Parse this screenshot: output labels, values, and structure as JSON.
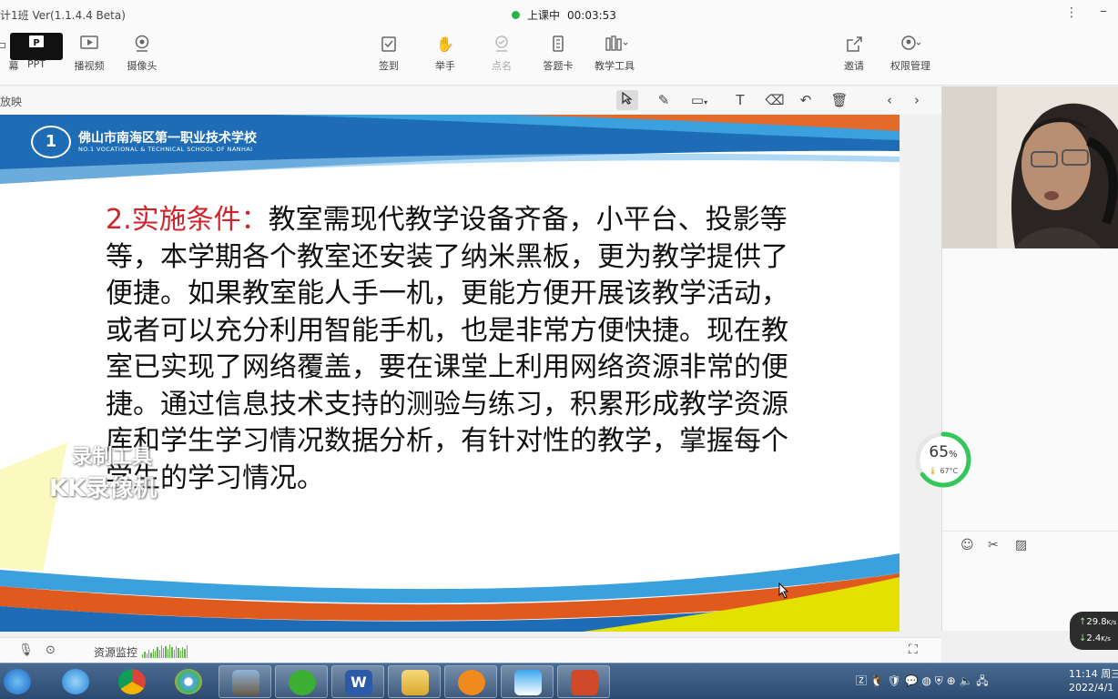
{
  "window": {
    "title": "计1班 Ver(1.1.4.4 Beta)",
    "live_status": "上课中",
    "timer": "00:03:53"
  },
  "toolbar": {
    "sources": [
      {
        "label": "幕",
        "icon": "screen-share-icon"
      },
      {
        "label": "PPT",
        "icon": "ppt-icon",
        "active": true
      },
      {
        "label": "播视频",
        "icon": "video-play-icon"
      },
      {
        "label": "摄像头",
        "icon": "camera-icon"
      }
    ],
    "tools": [
      {
        "label": "签到",
        "icon": "checkin-icon"
      },
      {
        "label": "举手",
        "icon": "raise-hand-icon"
      },
      {
        "label": "点名",
        "icon": "roll-call-icon",
        "disabled": true
      },
      {
        "label": "答题卡",
        "icon": "answer-card-icon"
      },
      {
        "label": "教学工具",
        "icon": "teaching-tools-icon"
      }
    ],
    "right": [
      {
        "label": "邀请",
        "icon": "invite-icon"
      },
      {
        "label": "权限管理",
        "icon": "permission-icon"
      }
    ]
  },
  "annotation_bar": {
    "label": "放映"
  },
  "slide": {
    "school_name": "佛山市南海区第一职业技术学校",
    "school_name_en": "NO.1 VOCATIONAL & TECHNICAL SCHOOL OF NANHAI",
    "logo_text": "1",
    "heading": "2.实施条件：",
    "body": "教室需现代教学设备齐备，小平台、投影等等，本学期各个教室还安装了纳米黑板，更为教学提供了便捷。如果教室能人手一机，更能方便开展该教学活动，或者可以充分利用智能手机，也是非常方便快捷。现在教室已实现了网络覆盖，要在课堂上利用网络资源非常的便捷。通过信息技术支持的测验与练习，积累形成教学资源库和学生学习情况数据分析，有针对性的教学，掌握每个学生的学习情况。"
  },
  "watermark": {
    "line1": "录制工具",
    "line2": "KK录像机"
  },
  "performance": {
    "cpu_percent": "65",
    "percent_sign": "%",
    "temperature": "67°C",
    "level": 0.65
  },
  "network": {
    "upload": "29.8",
    "download": "2.4",
    "unit": "K/s"
  },
  "statusbar": {
    "monitor_label": "资源监控"
  },
  "clock": {
    "time": "11:14 周三",
    "date": "2022/4/1"
  }
}
